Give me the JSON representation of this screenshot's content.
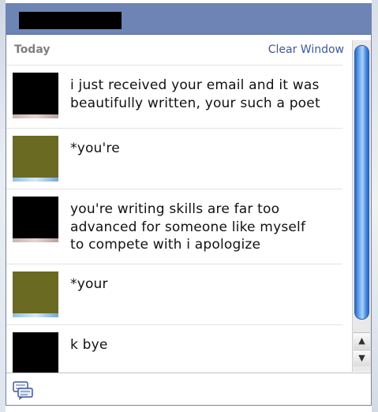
{
  "window": {
    "name_redacted": true
  },
  "header": {
    "today_label": "Today",
    "clear_window_label": "Clear Window"
  },
  "messages": [
    {
      "avatar": "black-redacted",
      "text": "i just received your email and it was\nbeautifully written, your such a poet"
    },
    {
      "avatar": "olive-redacted",
      "text": "*you're"
    },
    {
      "avatar": "black-redacted",
      "text": "you're writing skills are far too\nadvanced for someone like myself\nto compete with i apologize"
    },
    {
      "avatar": "olive-redacted",
      "text": "*your"
    },
    {
      "avatar": "black-redacted",
      "text": "k bye"
    }
  ],
  "scrollbar": {
    "up_arrow": "▲",
    "down_arrow": "▼"
  },
  "footer": {
    "icon": "chat-bubble-icon"
  },
  "colors": {
    "titlebar": "#6d84b4",
    "link": "#3b5998",
    "scroll_thumb": "#5a9be8"
  }
}
